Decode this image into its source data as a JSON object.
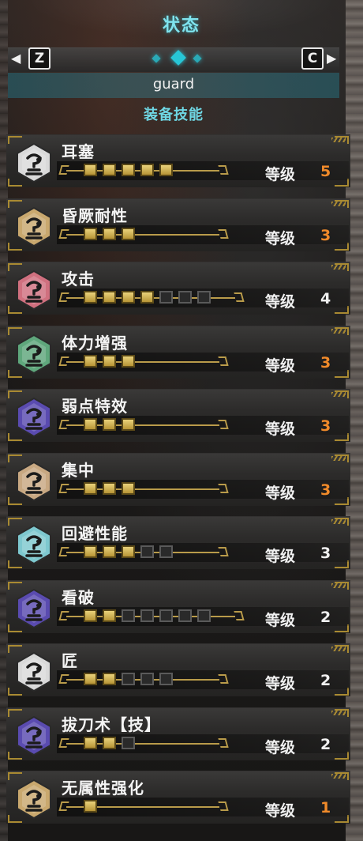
{
  "header": {
    "title": "状态",
    "left_key": "Z",
    "right_key": "C",
    "tab_count": 3,
    "active_tab": 1
  },
  "character_name": "guard",
  "section_title": "装备技能",
  "level_label": "等级",
  "colors": {
    "title_cyan": "#7fe3ee",
    "maxed_orange": "#f08a2a",
    "level_white": "#f0f0f0",
    "pip_gold": "#d8bd5c"
  },
  "skills": [
    {
      "name": "耳塞",
      "level": "5",
      "max_level": 5,
      "maxed": true,
      "icon": "white-jewel-icon",
      "icon_color": "#d9d9d9"
    },
    {
      "name": "昏厥耐性",
      "level": "3",
      "max_level": 3,
      "maxed": true,
      "icon": "tan-jewel-icon",
      "icon_color": "#c9a86e"
    },
    {
      "name": "攻击",
      "level": "4",
      "max_level": 7,
      "maxed": false,
      "icon": "red-jewel-icon",
      "icon_color": "#d0707f"
    },
    {
      "name": "体力增强",
      "level": "3",
      "max_level": 3,
      "maxed": true,
      "icon": "green-jewel-icon",
      "icon_color": "#5fa77c"
    },
    {
      "name": "弱点特效",
      "level": "3",
      "max_level": 3,
      "maxed": true,
      "icon": "purple-jewel-icon",
      "icon_color": "#5a4bb0"
    },
    {
      "name": "集中",
      "level": "3",
      "max_level": 3,
      "maxed": true,
      "icon": "beige-jewel-icon",
      "icon_color": "#c8a882"
    },
    {
      "name": "回避性能",
      "level": "3",
      "max_level": 5,
      "maxed": false,
      "icon": "cyan-jewel-icon",
      "icon_color": "#7ec8cf"
    },
    {
      "name": "看破",
      "level": "2",
      "max_level": 7,
      "maxed": false,
      "icon": "purple-jewel-icon",
      "icon_color": "#5a4bb0"
    },
    {
      "name": "匠",
      "level": "2",
      "max_level": 5,
      "maxed": false,
      "icon": "white-jewel-icon",
      "icon_color": "#d9d9d9"
    },
    {
      "name": "拔刀术【技】",
      "level": "2",
      "max_level": 3,
      "maxed": false,
      "icon": "purple-jewel-icon",
      "icon_color": "#5a4bb0"
    },
    {
      "name": "无属性强化",
      "level": "1",
      "max_level": 1,
      "maxed": true,
      "icon": "tan-jewel-icon",
      "icon_color": "#c9a86e"
    }
  ]
}
